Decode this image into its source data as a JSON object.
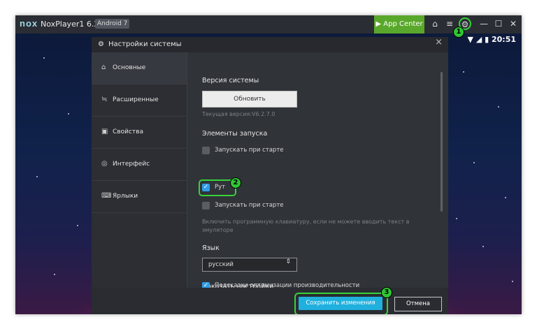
{
  "titlebar": {
    "logo": "nox",
    "app_name": "NoxPlayer1 6.2.7.0",
    "android_badge": "Android 7",
    "app_center_label": "App Center",
    "icons": [
      "shirt-icon",
      "menu-icon",
      "gear-icon",
      "minimize-icon",
      "maximize-icon",
      "close-icon"
    ]
  },
  "status_bar": {
    "time": "20:51"
  },
  "callouts": [
    "1",
    "2",
    "3"
  ],
  "dialog": {
    "title": "Настройки системы",
    "close": "×",
    "sidebar": [
      {
        "label": "Основные",
        "icon": "home-icon",
        "active": true
      },
      {
        "label": "Расширенные",
        "icon": "sliders-icon",
        "active": false
      },
      {
        "label": "Свойства",
        "icon": "info-icon",
        "active": false
      },
      {
        "label": "Интерфейс",
        "icon": "palette-icon",
        "active": false
      },
      {
        "label": "Ярлыки",
        "icon": "keyboard-icon",
        "active": false
      }
    ],
    "content": {
      "system_version_heading": "Версия системы",
      "update_button": "Обновить",
      "current_version": "Текущая версия:V6.2.7.0",
      "startup_heading": "Элементы запуска",
      "checkbox_autostart": {
        "label": "Запускать при старте",
        "checked": false
      },
      "checkbox_root": {
        "label": "Рут",
        "checked": true
      },
      "checkbox_autostart2": {
        "label": "Запускать при старте",
        "checked": false
      },
      "keyboard_hint": "Включить программную клавиатуру, если не можете вводить текст в эмуляторе",
      "language_heading": "Язык",
      "language_value": "русский",
      "show_settings_heading": "Показать настройки",
      "checkbox_tips": {
        "label": "Подсказки оптимизации производительности",
        "checked": true
      }
    },
    "footer": {
      "save_button": "Сохранить изменения",
      "cancel_button": "Отмена"
    }
  },
  "colors": {
    "accent_green": "#5aa82b",
    "highlight_green": "#36d23a",
    "save_blue": "#1fb0de",
    "checkbox_blue": "#2f9ee8"
  }
}
